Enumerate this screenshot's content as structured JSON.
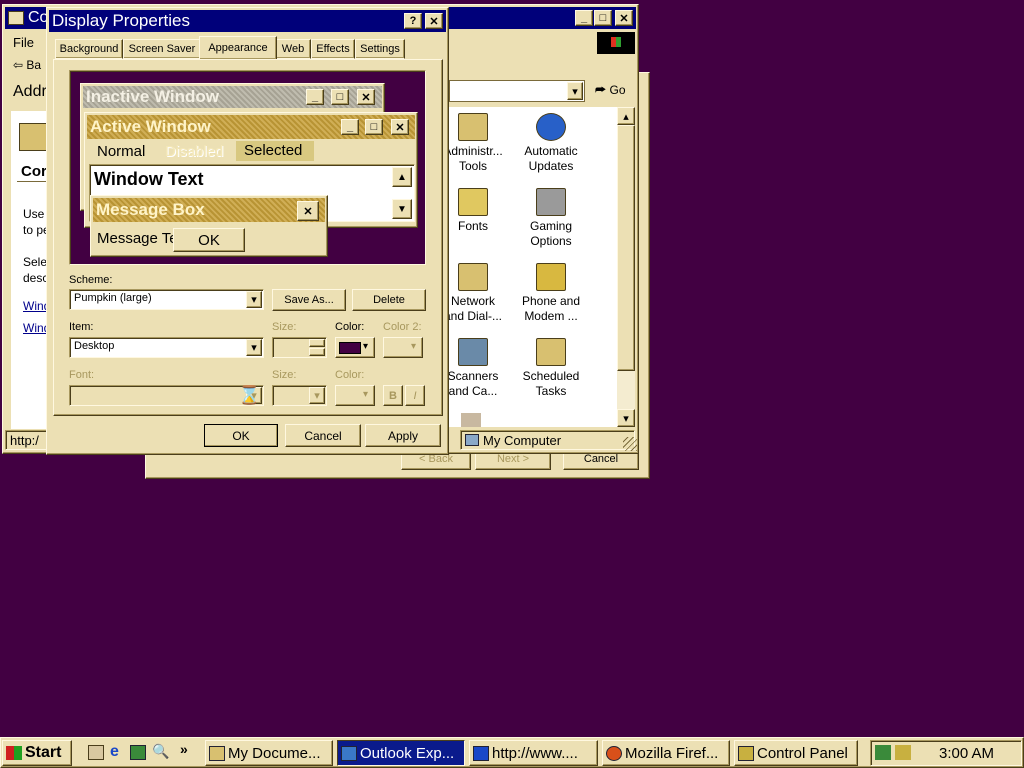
{
  "colors": {
    "desktop": "#420042",
    "face": "#ece0b4",
    "active_title": "#00007a",
    "scheme_active": "#c8a038",
    "scheme_inactive": "#b4b0a0"
  },
  "back_window": {
    "nav_buttons": {
      "back": "< Back",
      "next": "Next >",
      "cancel": "Cancel"
    }
  },
  "control_panel": {
    "title": "Co",
    "menu_file": "File",
    "back_label": "Ba",
    "address_label": "Addr",
    "go_label": "Go",
    "heading": "Cor",
    "desc1_line1": "Use",
    "desc1_line2": "to pe",
    "desc2_line1": "Sele",
    "desc2_line2": "desc",
    "link1": "Wind",
    "link2": "Wind",
    "status_left": "http:/",
    "status_zone": "My Computer",
    "icons": [
      {
        "name": "administrative-tools",
        "icon": "tools-icon",
        "line1": "Administr...",
        "line2": "Tools"
      },
      {
        "name": "automatic-updates",
        "icon": "globe-icon",
        "line1": "Automatic",
        "line2": "Updates"
      },
      {
        "name": "fonts",
        "icon": "fonts-icon",
        "line1": "Fonts",
        "line2": ""
      },
      {
        "name": "gaming-options",
        "icon": "joystick-icon",
        "line1": "Gaming",
        "line2": "Options"
      },
      {
        "name": "network-dialup",
        "icon": "network-icon",
        "line1": "Network",
        "line2": "and Dial-..."
      },
      {
        "name": "phone-modem",
        "icon": "phone-icon",
        "line1": "Phone and",
        "line2": "Modem ..."
      },
      {
        "name": "scanners-cameras",
        "icon": "scanner-icon",
        "line1": "Scanners",
        "line2": "and Ca..."
      },
      {
        "name": "scheduled-tasks",
        "icon": "tasks-icon",
        "line1": "Scheduled",
        "line2": "Tasks"
      }
    ]
  },
  "display_properties": {
    "title": "Display Properties",
    "tabs": [
      "Background",
      "Screen Saver",
      "Appearance",
      "Web",
      "Effects",
      "Settings"
    ],
    "active_tab": "Appearance",
    "preview": {
      "inactive_title": "Inactive Window",
      "active_title": "Active Window",
      "menu_normal": "Normal",
      "menu_disabled": "Disabled",
      "menu_selected": "Selected",
      "window_text": "Window Text",
      "msgbox_title": "Message Box",
      "msgbox_text": "Message Text",
      "ok": "OK"
    },
    "scheme_label": "Scheme:",
    "scheme_value": "Pumpkin (large)",
    "save_as": "Save As...",
    "delete": "Delete",
    "item_label": "Item:",
    "item_value": "Desktop",
    "size_label": "Size:",
    "color_label": "Color:",
    "color2_label": "Color 2:",
    "font_label": "Font:",
    "font_size_label": "Size:",
    "font_color_label": "Color:",
    "bold": "B",
    "italic": "I",
    "item_color": "#420042",
    "buttons": {
      "ok": "OK",
      "cancel": "Cancel",
      "apply": "Apply"
    }
  },
  "taskbar": {
    "start": "Start",
    "quick_more": "»",
    "items": [
      {
        "label": "My Docume...",
        "icon": "folder-search-icon",
        "active": false
      },
      {
        "label": "Outlook Exp...",
        "icon": "outlook-icon",
        "active": true
      },
      {
        "label": "http://www....",
        "icon": "ie-page-icon",
        "active": false
      },
      {
        "label": "Mozilla Firef...",
        "icon": "firefox-icon",
        "active": false
      },
      {
        "label": "Control Panel",
        "icon": "control-panel-icon",
        "active": false
      }
    ],
    "clock": "3:00 AM"
  }
}
